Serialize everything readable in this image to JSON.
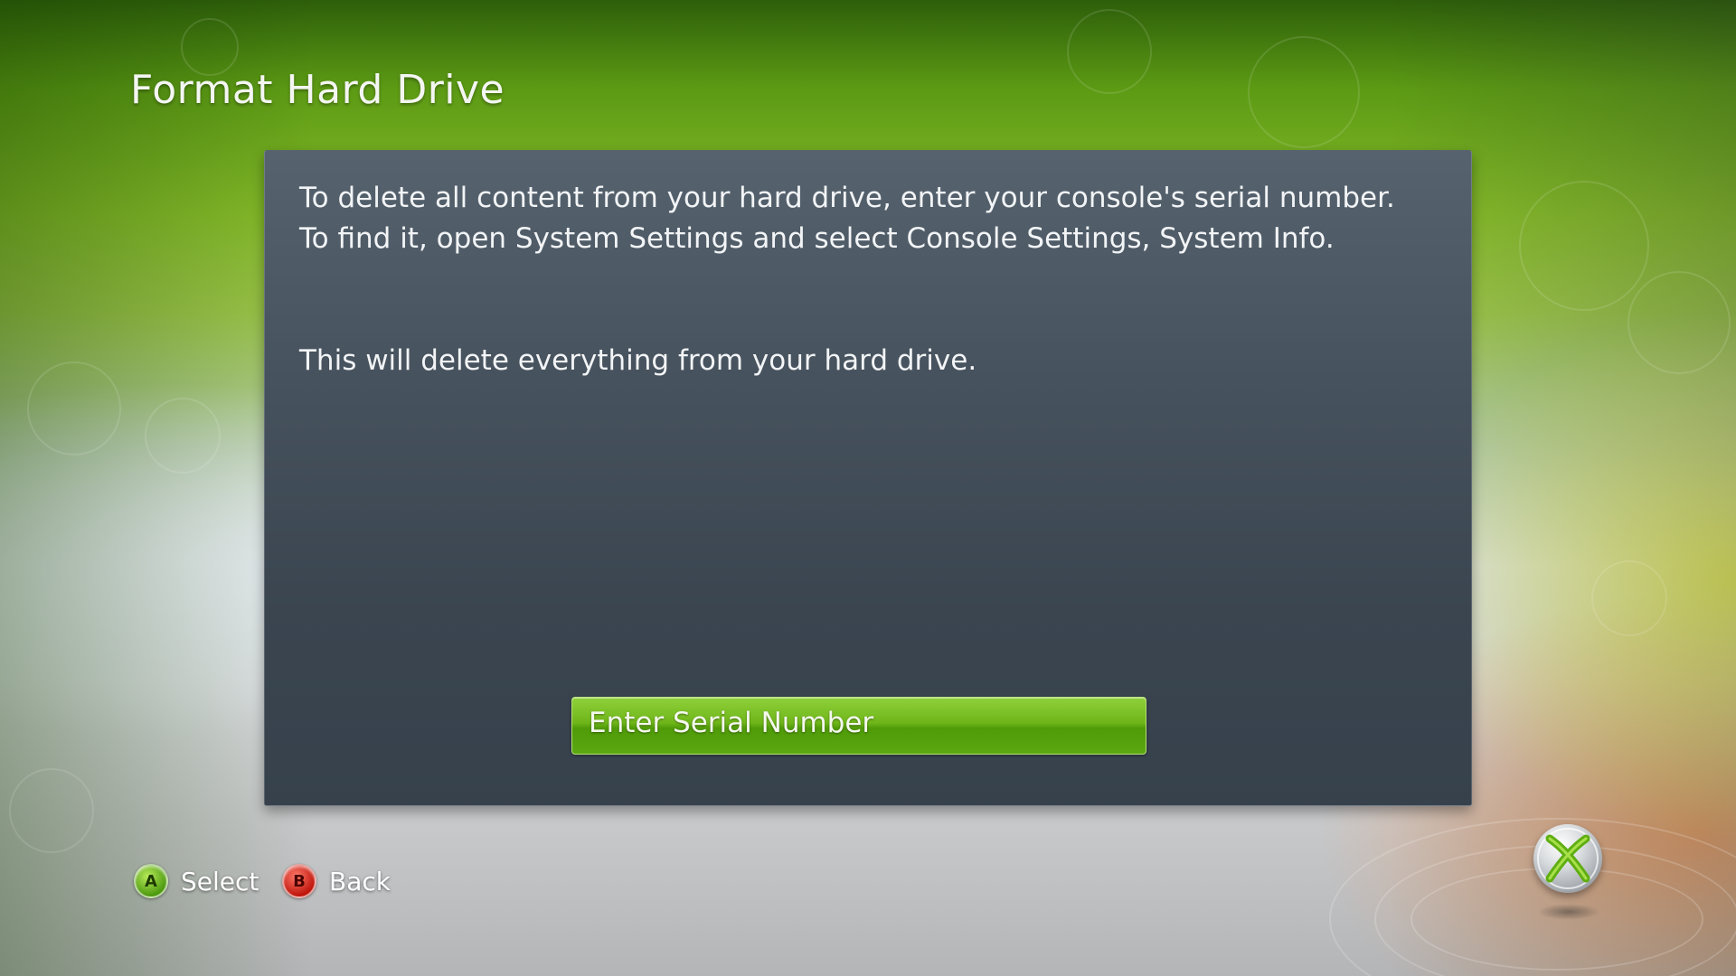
{
  "screen": {
    "title": "Format Hard Drive"
  },
  "dialog": {
    "paragraph_1": "To delete all content from your hard drive, enter your console's serial number. To find it, open System Settings and select Console Settings, System Info.",
    "paragraph_2": "This will delete everything from your hard drive.",
    "primary_button_label": "Enter Serial Number"
  },
  "button_hints": [
    {
      "glyph": "A",
      "label": "Select",
      "color": "#6fb61a",
      "icon": "a-button-icon"
    },
    {
      "glyph": "B",
      "label": "Back",
      "color": "#c0160c",
      "icon": "b-button-icon"
    }
  ],
  "logo": {
    "icon": "xbox-logo-icon"
  },
  "colors": {
    "accent_green": "#6fb61a",
    "dialog_bg": "#46525d",
    "text": "#f2f4f6"
  }
}
